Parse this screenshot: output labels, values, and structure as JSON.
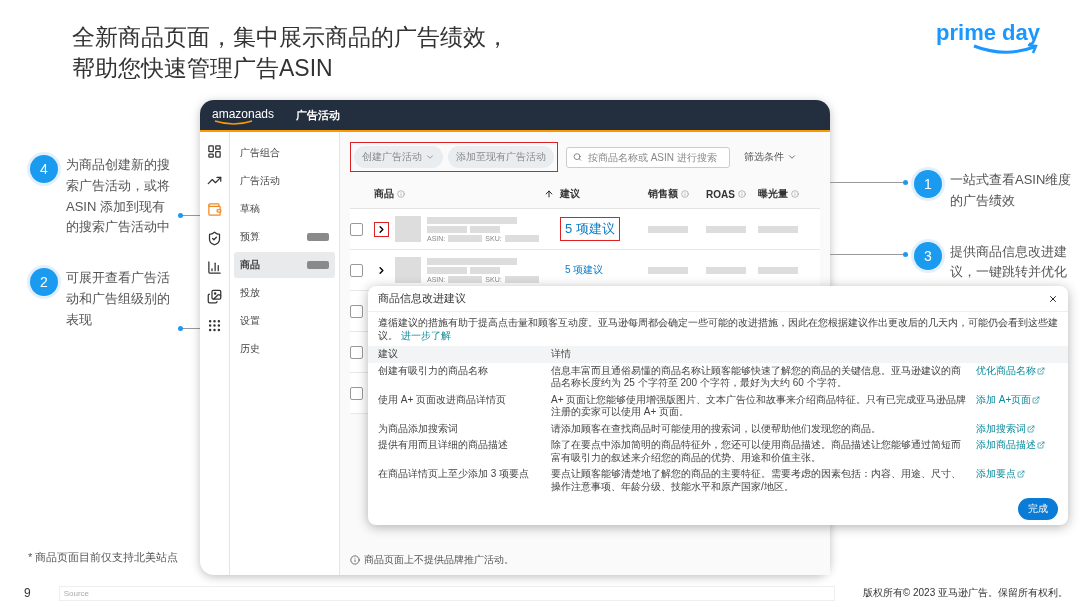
{
  "slide": {
    "title_lines": [
      "全新商品页面，集中展示商品的广告绩效，",
      "帮助您快速管理广告ASIN"
    ],
    "brand": "prime day"
  },
  "left_callouts": [
    {
      "number": "4",
      "text": "为商品创建新的搜索广告活动，或将 ASIN 添加到现有的搜索广告活动中"
    },
    {
      "number": "2",
      "text": "可展开查看广告活动和广告组级别的表现"
    }
  ],
  "right_callouts": [
    {
      "number": "1",
      "text": "一站式查看ASIN维度的广告绩效"
    },
    {
      "number": "3",
      "text": "提供商品信息改进建议，一键跳转并优化"
    }
  ],
  "app": {
    "logo": "amazonads",
    "header_title": "广告活动",
    "rail_icons": [
      {
        "selected": false
      },
      {
        "selected": false
      },
      {
        "selected": true
      },
      {
        "selected": false
      },
      {
        "selected": false
      },
      {
        "selected": false
      },
      {
        "selected": false
      }
    ],
    "nav": [
      {
        "label": "广告组合",
        "selected": false,
        "badge": false
      },
      {
        "label": "广告活动",
        "selected": false,
        "badge": false
      },
      {
        "label": "草稿",
        "selected": false,
        "badge": false
      },
      {
        "label": "预算",
        "selected": false,
        "badge": true
      },
      {
        "label": "商品",
        "selected": true,
        "badge": true
      },
      {
        "label": "投放",
        "selected": false,
        "badge": false
      },
      {
        "label": "设置",
        "selected": false,
        "badge": false
      },
      {
        "label": "历史",
        "selected": false,
        "badge": false
      }
    ],
    "toolbar": {
      "highlighted": true,
      "create_button": "创建广告活动",
      "add_button": "添加至现有广告活动",
      "search": {
        "placeholder": "按商品名称或 ASIN 进行搜索"
      },
      "filter": "筛选条件"
    },
    "table": {
      "columns": [
        "商品",
        "建议",
        "销售额",
        "ROAS",
        "曝光量"
      ],
      "rows": [
        {
          "checked": false,
          "highlighted": true,
          "asin_label": "ASIN:",
          "sku_label": "SKU:",
          "suggestion": "5 项建议"
        },
        {
          "checked": false,
          "highlighted": false,
          "asin_label": "ASIN:",
          "sku_label": "SKU:",
          "suggestion": "5 项建议"
        },
        {
          "checked": false
        },
        {
          "checked": false
        },
        {
          "checked": false
        }
      ]
    },
    "note": "商品页面上不提供品牌推广活动。",
    "dialog": {
      "title": "商品信息改进建议",
      "intro": "遵循建议的措施有助于提高点击量和顾客互动度。亚马逊每周都会确定一些可能的改进措施，因此在您根据建议作出更改后的几天内，可能仍会看到这些建议。",
      "intro_link": "进一步了解",
      "columns": [
        "建议",
        "详情"
      ],
      "rows": [
        {
          "suggestion": "创建有吸引力的商品名称",
          "detail": "信息丰富而且通俗易懂的商品名称让顾客能够快速了解您的商品的关键信息。亚马逊建议的商品名称长度约为 25 个字符至 200 个字符，最好为大约 60 个字符。",
          "action": "优化商品名称"
        },
        {
          "suggestion": "使用 A+ 页面改进商品详情页",
          "detail": "A+ 页面让您能够使用增强版图片、文本广告位和故事来介绍商品特征。只有已完成亚马逊品牌注册的卖家可以使用 A+ 页面。",
          "action": "添加 A+页面"
        },
        {
          "suggestion": "为商品添加搜索词",
          "detail": "请添加顾客在查找商品时可能使用的搜索词，以便帮助他们发现您的商品。",
          "action": "添加搜索词"
        },
        {
          "suggestion": "提供有用而且详细的商品描述",
          "detail": "除了在要点中添加简明的商品特征外，您还可以使用商品描述。商品描述让您能够通过简短而富有吸引力的叙述来介绍您的商品的优势、用途和价值主张。",
          "action": "添加商品描述"
        },
        {
          "suggestion": "在商品详情页上至少添加 3 项要点",
          "detail": "要点让顾客能够清楚地了解您的商品的主要特征。需要考虑的因素包括：内容、用途、尺寸、操作注意事项、年龄分级、技能水平和原产国家/地区。",
          "action": "添加要点"
        }
      ],
      "done_button": "完成"
    }
  },
  "footnote": "* 商品页面目前仅支持北美站点",
  "footer": {
    "page": "9",
    "source": "Source",
    "copyright": "版权所有© 2023 亚马逊广告。保留所有权利。"
  }
}
